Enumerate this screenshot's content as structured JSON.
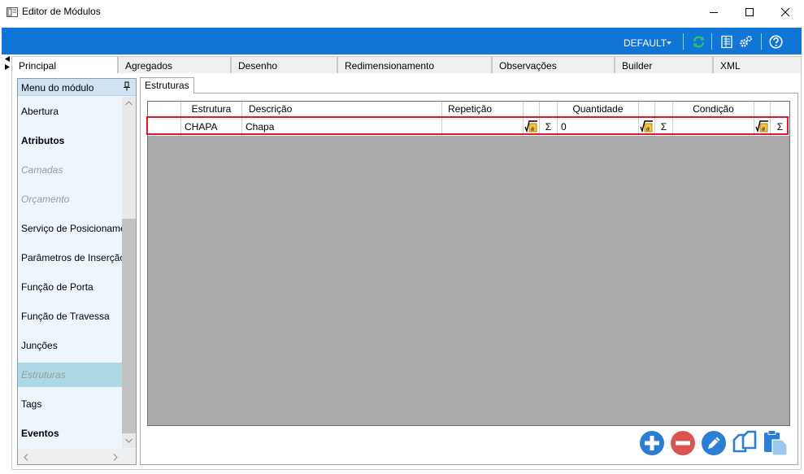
{
  "window": {
    "title": "Editor de Módulos"
  },
  "toolbar": {
    "profile": "DEFAULT",
    "icons": [
      "refresh-icon",
      "list-icon",
      "settings-icon",
      "help-icon"
    ]
  },
  "tabs": [
    "Principal",
    "Agregados",
    "Desenho",
    "Redimensionamento",
    "Observações",
    "Builder",
    "XML"
  ],
  "menu": {
    "header": "Menu do módulo",
    "items": [
      {
        "label": "Abertura",
        "style": "normal"
      },
      {
        "label": "Atributos",
        "style": "bold"
      },
      {
        "label": "Camadas",
        "style": "disabled"
      },
      {
        "label": "Orçamento",
        "style": "disabled"
      },
      {
        "label": "Serviço de Posicionamento",
        "style": "normal"
      },
      {
        "label": "Parâmetros de Inserção",
        "style": "normal"
      },
      {
        "label": "Função de Porta",
        "style": "normal"
      },
      {
        "label": "Função de Travessa",
        "style": "normal"
      },
      {
        "label": "Junções",
        "style": "normal"
      },
      {
        "label": "Estruturas",
        "style": "selected"
      },
      {
        "label": "Tags",
        "style": "normal"
      },
      {
        "label": "Eventos",
        "style": "bold"
      }
    ]
  },
  "inner_tab": "Estruturas",
  "grid": {
    "columns": [
      "Estrutura",
      "Descrição",
      "Repetição",
      "Quantidade",
      "Condição"
    ],
    "rows": [
      {
        "estrutura": "CHAPA",
        "descricao": "Chapa",
        "repeticao": "",
        "quantidade": "0",
        "condicao": ""
      }
    ],
    "sigma": "Σ"
  },
  "actions": [
    "add-icon",
    "remove-icon",
    "edit-icon",
    "copy-icon",
    "paste-icon"
  ],
  "colors": {
    "toolbar": "#0f76d7",
    "highlight": "#e0182c",
    "add": "#2a7fd4",
    "remove": "#d9534f",
    "edit": "#2a7fd4"
  }
}
